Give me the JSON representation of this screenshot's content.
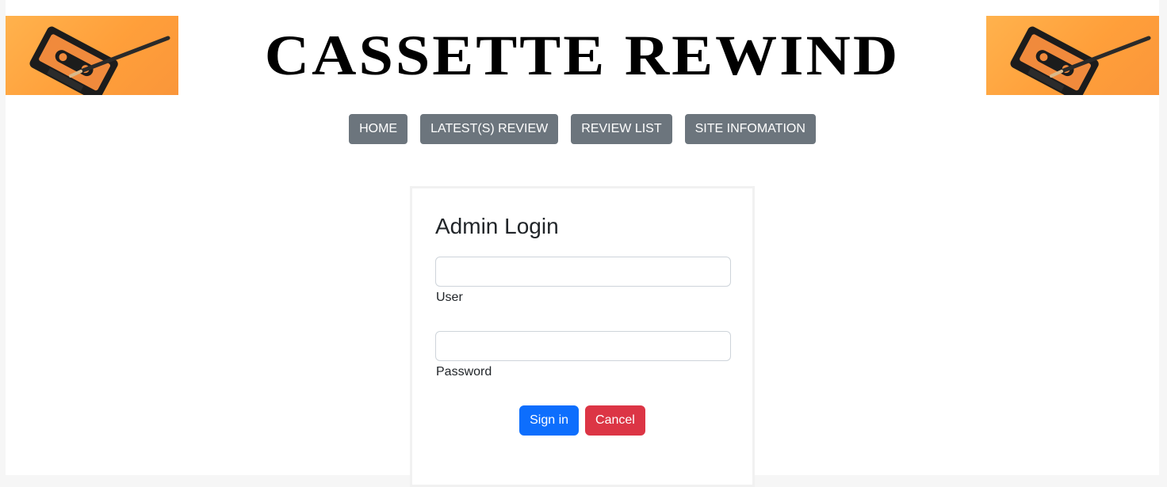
{
  "header": {
    "site_title": "CASSETTE REWIND"
  },
  "nav": {
    "items": [
      {
        "label": "HOME"
      },
      {
        "label": "LATEST(S) REVIEW"
      },
      {
        "label": "REVIEW LIST"
      },
      {
        "label": "SITE INFOMATION"
      }
    ]
  },
  "login": {
    "title": "Admin Login",
    "user_label": "User",
    "user_value": "",
    "password_label": "Password",
    "password_value": "",
    "sign_in_label": "Sign in",
    "cancel_label": "Cancel"
  },
  "colors": {
    "banner_orange": "#ffa64a",
    "nav_button": "#6c757d",
    "primary": "#0d6efd",
    "danger": "#dc3545"
  },
  "icons": {
    "banner_image": "cassette-tape-icon"
  }
}
